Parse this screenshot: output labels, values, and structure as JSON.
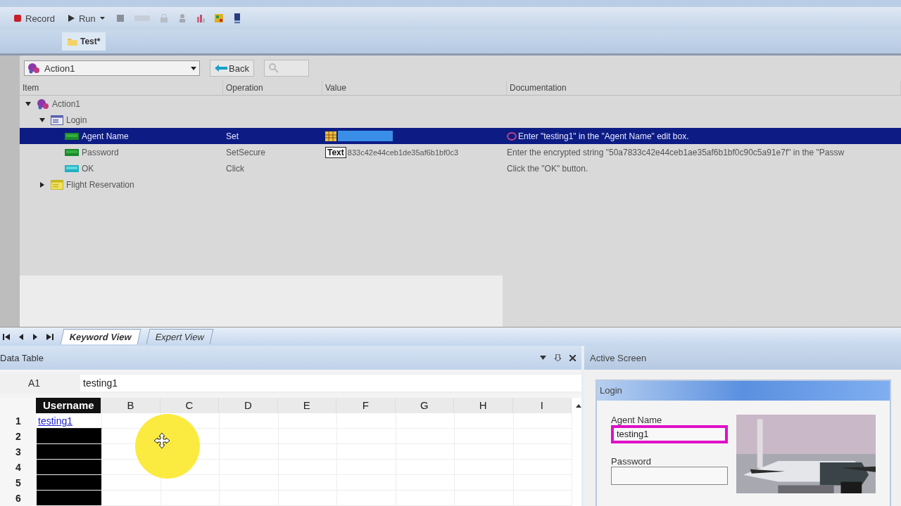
{
  "toolbar": {
    "buttons": [
      {
        "label": "Record",
        "kind": "record"
      },
      {
        "label": "Run",
        "kind": "run"
      }
    ]
  },
  "document_tabs": [
    {
      "label": "Test*",
      "selected": true
    }
  ],
  "action_selector": {
    "value": "Action1"
  },
  "nav_buttons": [
    {
      "label": "Back",
      "disabled": false
    },
    {
      "disabled": true
    }
  ],
  "keyword_grid": {
    "columns": [
      "Item",
      "Operation",
      "Value",
      "Documentation"
    ],
    "rows": [
      {
        "item": "Action1",
        "kind": "action",
        "expanded": true,
        "selected": false,
        "children": [
          {
            "item": "Login",
            "kind": "window",
            "expanded": true,
            "selected": false,
            "children": [
              {
                "item": "Agent Name",
                "kind": "edit",
                "selected": true,
                "operation": "Set",
                "editing": true,
                "documentation": "Enter \"testing1\" in the \"Agent Name\" edit box."
              },
              {
                "item": "Password",
                "kind": "edit",
                "selected": false,
                "operation": "SetSecure",
                "value": "833c42e44ceb1de35af6b1bf0c3",
                "value_tag": "Text",
                "documentation": "Enter the encrypted string \"50a7833c42e44ceb1ae35af6b1bf0c90c5a91e7f\" in the \"Passw"
              },
              {
                "item": "OK",
                "kind": "button",
                "selected": false,
                "operation": "Click",
                "documentation": "Click the \"OK\" button."
              }
            ]
          },
          {
            "item": "Flight Reservation",
            "kind": "window",
            "expanded": false,
            "selected": false
          }
        ]
      }
    ]
  },
  "view_tabs": [
    {
      "label": "Keyword View",
      "selected": true
    },
    {
      "label": "Expert View",
      "selected": false
    }
  ],
  "data_table": {
    "title": "Data Table",
    "cell_ref": "A1",
    "cell_value": "testing1",
    "columns": [
      {
        "label": "Username",
        "selected": true
      },
      {
        "label": "B",
        "selected": false
      },
      {
        "label": "C",
        "selected": false
      },
      {
        "label": "D",
        "selected": false
      },
      {
        "label": "E",
        "selected": false
      },
      {
        "label": "F",
        "selected": false
      },
      {
        "label": "G",
        "selected": false
      },
      {
        "label": "H",
        "selected": false
      },
      {
        "label": "I",
        "selected": false
      }
    ],
    "rows": [
      {
        "number": "1",
        "cells": [
          "testing1"
        ]
      },
      {
        "number": "2",
        "cells": []
      },
      {
        "number": "3",
        "cells": []
      },
      {
        "number": "4",
        "cells": []
      },
      {
        "number": "5",
        "cells": []
      },
      {
        "number": "6",
        "cells": []
      }
    ]
  },
  "active_screen": {
    "title": "Active Screen",
    "window_title": "Login",
    "fields": [
      {
        "label": "Agent Name",
        "value": "testing1",
        "highlighted": true
      },
      {
        "label": "Password",
        "highlighted": false
      }
    ]
  }
}
